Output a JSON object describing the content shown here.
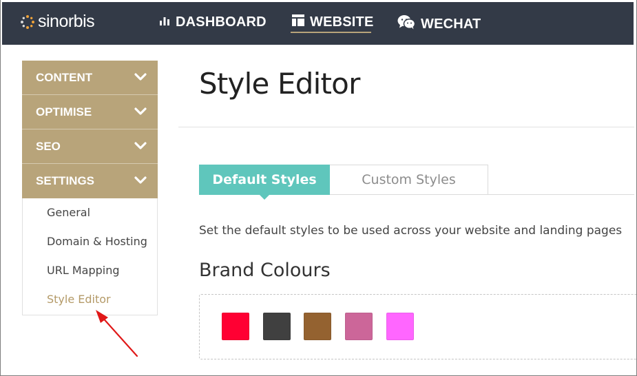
{
  "logo": {
    "text": "sinorbis"
  },
  "nav": {
    "items": [
      {
        "label": "DASHBOARD",
        "icon": "bar-chart-icon"
      },
      {
        "label": "WEBSITE",
        "icon": "layout-icon",
        "active": true
      },
      {
        "label": "WECHAT",
        "icon": "wechat-icon"
      }
    ]
  },
  "sidebar": {
    "sections": [
      {
        "label": "CONTENT"
      },
      {
        "label": "OPTIMISE"
      },
      {
        "label": "SEO"
      },
      {
        "label": "SETTINGS",
        "expanded": true
      }
    ],
    "settings_items": [
      {
        "label": "General"
      },
      {
        "label": "Domain & Hosting"
      },
      {
        "label": "URL Mapping"
      },
      {
        "label": "Style Editor",
        "active": true
      }
    ]
  },
  "main": {
    "title": "Style Editor",
    "tabs": [
      {
        "label": "Default Styles",
        "active": true
      },
      {
        "label": "Custom Styles"
      }
    ],
    "description": "Set the default styles to be used across your website and landing pages",
    "brand_colours": {
      "heading": "Brand Colours",
      "swatches": [
        "#ff0033",
        "#404040",
        "#946230",
        "#cc6699",
        "#ff66ff"
      ]
    }
  },
  "colors": {
    "topbar": "#333a47",
    "accent": "#b8a47a",
    "tab_active": "#5fc6bc",
    "annotation_arrow": "#e01818"
  }
}
